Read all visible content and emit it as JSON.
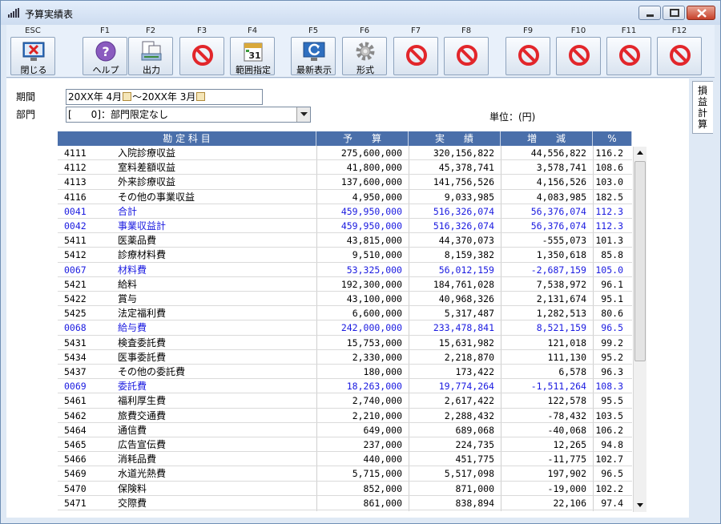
{
  "window": {
    "title": "予算実績表"
  },
  "toolbar": {
    "keys": [
      {
        "key": "ESC",
        "label": "閉じる",
        "icon": "close-window-icon"
      },
      {
        "key": "F1",
        "label": "ヘルプ",
        "icon": "help-icon"
      },
      {
        "key": "F2",
        "label": "出力",
        "icon": "print-icon"
      },
      {
        "key": "F3",
        "label": "",
        "icon": "prohibited-icon"
      },
      {
        "key": "F4",
        "label": "範囲指定",
        "icon": "calendar-icon"
      },
      {
        "key": "F5",
        "label": "最新表示",
        "icon": "refresh-icon"
      },
      {
        "key": "F6",
        "label": "形式",
        "icon": "gear-icon"
      },
      {
        "key": "F7",
        "label": "",
        "icon": "prohibited-icon"
      },
      {
        "key": "F8",
        "label": "",
        "icon": "prohibited-icon"
      },
      {
        "key": "F9",
        "label": "",
        "icon": "prohibited-icon"
      },
      {
        "key": "F10",
        "label": "",
        "icon": "prohibited-icon"
      },
      {
        "key": "F11",
        "label": "",
        "icon": "prohibited-icon"
      },
      {
        "key": "F12",
        "label": "",
        "icon": "prohibited-icon"
      }
    ]
  },
  "filters": {
    "period_label": "期間",
    "period_from": "20XX年 4月",
    "period_sep": "～",
    "period_to": "20XX年 3月",
    "dept_label": "部門",
    "dept_value": "[　　0]：部門限定なし",
    "unit_label": "単位：(円)"
  },
  "side_tab": {
    "label": "損益計算"
  },
  "table": {
    "headers": [
      "勘 定 科 目",
      "予　　算",
      "実　　績",
      "増　　減",
      "%"
    ],
    "rows": [
      {
        "code": "4111",
        "name": "入院診療収益",
        "budget": "275,600,000",
        "actual": "320,156,822",
        "diff": "44,556,822",
        "pct": "116.2",
        "sub": false
      },
      {
        "code": "4112",
        "name": "室料差額収益",
        "budget": "41,800,000",
        "actual": "45,378,741",
        "diff": "3,578,741",
        "pct": "108.6",
        "sub": false
      },
      {
        "code": "4113",
        "name": "外来診療収益",
        "budget": "137,600,000",
        "actual": "141,756,526",
        "diff": "4,156,526",
        "pct": "103.0",
        "sub": false
      },
      {
        "code": "4116",
        "name": "その他の事業収益",
        "budget": "4,950,000",
        "actual": "9,033,985",
        "diff": "4,083,985",
        "pct": "182.5",
        "sub": false
      },
      {
        "code": "0041",
        "name": "合計",
        "budget": "459,950,000",
        "actual": "516,326,074",
        "diff": "56,376,074",
        "pct": "112.3",
        "sub": true
      },
      {
        "code": "0042",
        "name": "事業収益計",
        "budget": "459,950,000",
        "actual": "516,326,074",
        "diff": "56,376,074",
        "pct": "112.3",
        "sub": true
      },
      {
        "code": "5411",
        "name": "医薬品費",
        "budget": "43,815,000",
        "actual": "44,370,073",
        "diff": "-555,073",
        "pct": "101.3",
        "sub": false
      },
      {
        "code": "5412",
        "name": "診療材料費",
        "budget": "9,510,000",
        "actual": "8,159,382",
        "diff": "1,350,618",
        "pct": "85.8",
        "sub": false
      },
      {
        "code": "0067",
        "name": "材料費",
        "budget": "53,325,000",
        "actual": "56,012,159",
        "diff": "-2,687,159",
        "pct": "105.0",
        "sub": true
      },
      {
        "code": "5421",
        "name": "給料",
        "budget": "192,300,000",
        "actual": "184,761,028",
        "diff": "7,538,972",
        "pct": "96.1",
        "sub": false
      },
      {
        "code": "5422",
        "name": "賞与",
        "budget": "43,100,000",
        "actual": "40,968,326",
        "diff": "2,131,674",
        "pct": "95.1",
        "sub": false
      },
      {
        "code": "5425",
        "name": "法定福利費",
        "budget": "6,600,000",
        "actual": "5,317,487",
        "diff": "1,282,513",
        "pct": "80.6",
        "sub": false
      },
      {
        "code": "0068",
        "name": "給与費",
        "budget": "242,000,000",
        "actual": "233,478,841",
        "diff": "8,521,159",
        "pct": "96.5",
        "sub": true
      },
      {
        "code": "5431",
        "name": "検査委託費",
        "budget": "15,753,000",
        "actual": "15,631,982",
        "diff": "121,018",
        "pct": "99.2",
        "sub": false
      },
      {
        "code": "5434",
        "name": "医事委託費",
        "budget": "2,330,000",
        "actual": "2,218,870",
        "diff": "111,130",
        "pct": "95.2",
        "sub": false
      },
      {
        "code": "5437",
        "name": "その他の委託費",
        "budget": "180,000",
        "actual": "173,422",
        "diff": "6,578",
        "pct": "96.3",
        "sub": false
      },
      {
        "code": "0069",
        "name": "委託費",
        "budget": "18,263,000",
        "actual": "19,774,264",
        "diff": "-1,511,264",
        "pct": "108.3",
        "sub": true
      },
      {
        "code": "5461",
        "name": "福利厚生費",
        "budget": "2,740,000",
        "actual": "2,617,422",
        "diff": "122,578",
        "pct": "95.5",
        "sub": false
      },
      {
        "code": "5462",
        "name": "旅費交通費",
        "budget": "2,210,000",
        "actual": "2,288,432",
        "diff": "-78,432",
        "pct": "103.5",
        "sub": false
      },
      {
        "code": "5464",
        "name": "通信費",
        "budget": "649,000",
        "actual": "689,068",
        "diff": "-40,068",
        "pct": "106.2",
        "sub": false
      },
      {
        "code": "5465",
        "name": "広告宣伝費",
        "budget": "237,000",
        "actual": "224,735",
        "diff": "12,265",
        "pct": "94.8",
        "sub": false
      },
      {
        "code": "5466",
        "name": "消耗品費",
        "budget": "440,000",
        "actual": "451,775",
        "diff": "-11,775",
        "pct": "102.7",
        "sub": false
      },
      {
        "code": "5469",
        "name": "水道光熱費",
        "budget": "5,715,000",
        "actual": "5,517,098",
        "diff": "197,902",
        "pct": "96.5",
        "sub": false
      },
      {
        "code": "5470",
        "name": "保険料",
        "budget": "852,000",
        "actual": "871,000",
        "diff": "-19,000",
        "pct": "102.2",
        "sub": false
      },
      {
        "code": "5471",
        "name": "交際費",
        "budget": "861,000",
        "actual": "838,894",
        "diff": "22,106",
        "pct": "97.4",
        "sub": false
      }
    ]
  }
}
